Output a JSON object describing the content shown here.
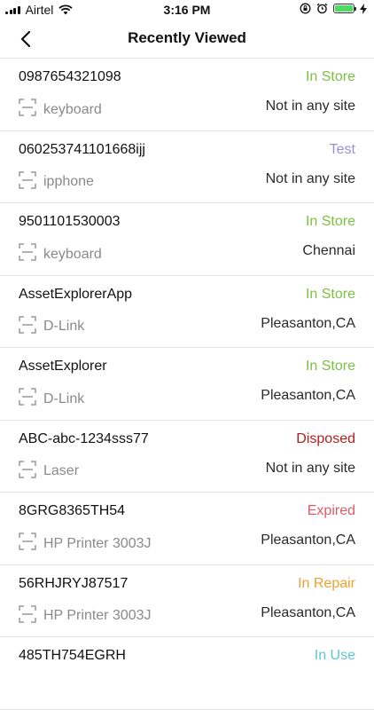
{
  "status_bar": {
    "carrier": "Airtel",
    "time": "3:16 PM",
    "icons": [
      "signal-icon",
      "wifi-icon",
      "lock-rotation-icon",
      "alarm-icon",
      "battery-icon",
      "charging-icon"
    ]
  },
  "nav": {
    "title": "Recently Viewed",
    "back_icon": "chevron-left-icon"
  },
  "colors": {
    "In Store": "#7ac143",
    "Test": "#9b8fd6",
    "Disposed": "#b21f1f",
    "Expired": "#e05a6a",
    "In Repair": "#f0a030",
    "In Use": "#5ac8d8"
  },
  "items": [
    {
      "asset_id": "0987654321098",
      "status": "In Store",
      "name": "keyboard",
      "site": "Not in any site"
    },
    {
      "asset_id": "060253741101668ijj",
      "status": "Test",
      "name": "ipphone",
      "site": "Not in any site"
    },
    {
      "asset_id": "9501101530003",
      "status": "In Store",
      "name": "keyboard",
      "site": "Chennai"
    },
    {
      "asset_id": "AssetExplorerApp",
      "status": "In Store",
      "name": "D-Link",
      "site": "Pleasanton,CA"
    },
    {
      "asset_id": "AssetExplorer",
      "status": "In Store",
      "name": "D-Link",
      "site": "Pleasanton,CA"
    },
    {
      "asset_id": "ABC-abc-1234sss77",
      "status": "Disposed",
      "name": "Laser",
      "site": "Not in any site"
    },
    {
      "asset_id": "8GRG8365TH54",
      "status": "Expired",
      "name": "HP Printer 3003J",
      "site": "Pleasanton,CA"
    },
    {
      "asset_id": "56RHJRYJ87517",
      "status": "In Repair",
      "name": "HP Printer 3003J",
      "site": "Pleasanton,CA"
    },
    {
      "asset_id": "485TH754EGRH",
      "status": "In Use",
      "name": "",
      "site": ""
    }
  ]
}
